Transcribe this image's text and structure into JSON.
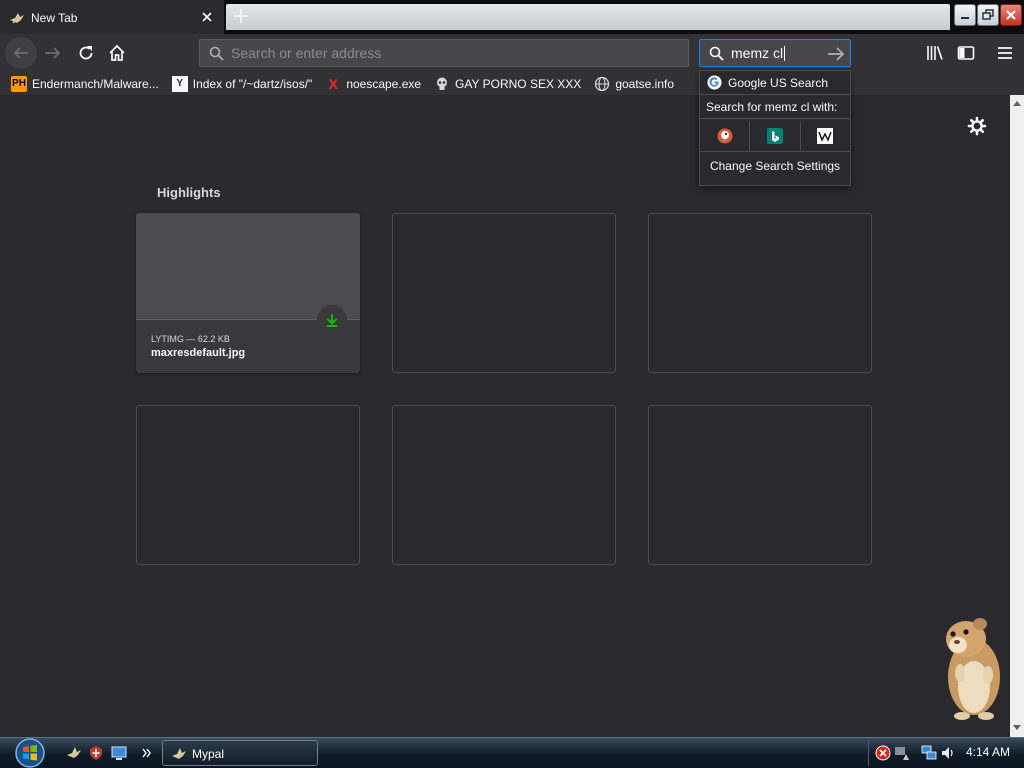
{
  "tab": {
    "title": "New Tab",
    "icon": "bird-icon"
  },
  "window_controls": {
    "minimize": "minimize-icon",
    "restore": "restore-icon",
    "close": "close-icon"
  },
  "navbar": {
    "url_placeholder": "Search or enter address",
    "search_value": "memz cl"
  },
  "bookmarks": [
    {
      "label": "Endermanch/Malware...",
      "icon": "PH"
    },
    {
      "label": "Index of \"/~dartz/isos/\"",
      "icon": "Y"
    },
    {
      "label": "noescape.exe",
      "icon": "X"
    },
    {
      "label": "GAY PORNO SEX XXX",
      "icon": "skull-icon"
    },
    {
      "label": "goatse.info",
      "icon": "globe-icon"
    }
  ],
  "search_dropdown": {
    "engine": "Google US Search",
    "search_for": "Search for memz cl with:",
    "engines": [
      "duckduckgo-icon",
      "bing-icon",
      "wikipedia-icon"
    ],
    "settings": "Change Search Settings"
  },
  "highlights": {
    "title": "Highlights",
    "card": {
      "meta": "LYTIMG — 62.2 KB",
      "name": "maxresdefault.jpg"
    }
  },
  "taskbar": {
    "task_label": "Mypal",
    "clock": "4:14 AM"
  },
  "colors": {
    "background": "#2a2a2e",
    "toolbar": "#323234",
    "accent": "#0a84ff",
    "download_green": "#12bc00"
  }
}
